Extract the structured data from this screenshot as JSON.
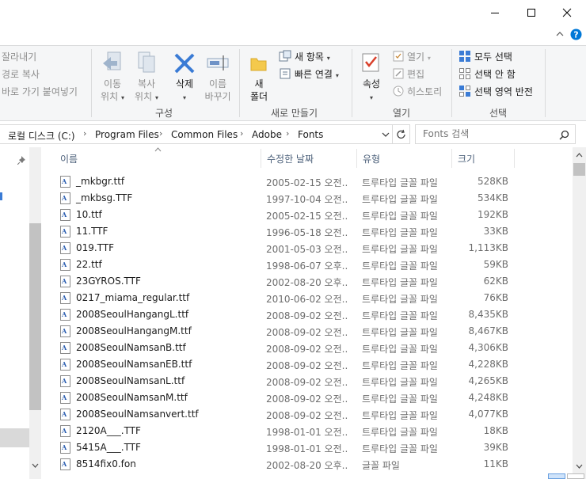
{
  "window": {
    "minimize_label": "minimize",
    "maximize_label": "maximize",
    "close_label": "close"
  },
  "ribbon": {
    "clipboard": {
      "cut": "잘라내기",
      "copy_path": "경로 복사",
      "paste_shortcut": "바로 가기 붙여넣기"
    },
    "organize": {
      "move_line1": "이동",
      "move_line2": "위치",
      "copy_line1": "복사",
      "copy_line2": "위치",
      "delete": "삭제",
      "rename_line1": "이름",
      "rename_line2": "바꾸기",
      "group_label": "구성"
    },
    "new": {
      "folder_line1": "새",
      "folder_line2": "폴더",
      "new_item": "새 항목",
      "easy_access": "빠른 연결",
      "group_label": "새로 만들기"
    },
    "open": {
      "properties": "속성",
      "open": "열기",
      "edit": "편집",
      "history": "히스토리",
      "group_label": "열기"
    },
    "select": {
      "select_all": "모두 선택",
      "select_none": "선택 안 함",
      "invert": "선택 영역 반전",
      "group_label": "선택"
    }
  },
  "address": {
    "crumbs": [
      "로컬 디스크 (C:)",
      "Program Files",
      "Common Files",
      "Adobe",
      "Fonts"
    ],
    "search_placeholder": "Fonts 검색"
  },
  "columns": {
    "name": "이름",
    "date": "수정한 날짜",
    "type": "유형",
    "size": "크기"
  },
  "files": [
    {
      "name": "_mkbgr.ttf",
      "date": "2005-02-15 오전...",
      "type": "트루타입 글꼴 파일",
      "size": "528KB"
    },
    {
      "name": "_mkbsg.TTF",
      "date": "1997-10-04 오전...",
      "type": "트루타입 글꼴 파일",
      "size": "534KB"
    },
    {
      "name": "10.ttf",
      "date": "2005-02-15 오전...",
      "type": "트루타입 글꼴 파일",
      "size": "192KB"
    },
    {
      "name": "11.TTF",
      "date": "1996-05-18 오전...",
      "type": "트루타입 글꼴 파일",
      "size": "33KB"
    },
    {
      "name": "019.TTF",
      "date": "2001-05-03 오전...",
      "type": "트루타입 글꼴 파일",
      "size": "1,113KB"
    },
    {
      "name": "22.ttf",
      "date": "1998-06-07 오후...",
      "type": "트루타입 글꼴 파일",
      "size": "59KB"
    },
    {
      "name": "23GYROS.TTF",
      "date": "2002-08-20 오후...",
      "type": "트루타입 글꼴 파일",
      "size": "62KB"
    },
    {
      "name": "0217_miama_regular.ttf",
      "date": "2010-06-02 오전...",
      "type": "트루타입 글꼴 파일",
      "size": "76KB"
    },
    {
      "name": "2008SeoulHangangL.ttf",
      "date": "2008-09-02 오전...",
      "type": "트루타입 글꼴 파일",
      "size": "8,435KB"
    },
    {
      "name": "2008SeoulHangangM.ttf",
      "date": "2008-09-02 오전...",
      "type": "트루타입 글꼴 파일",
      "size": "8,467KB"
    },
    {
      "name": "2008SeoulNamsanB.ttf",
      "date": "2008-09-02 오전...",
      "type": "트루타입 글꼴 파일",
      "size": "4,306KB"
    },
    {
      "name": "2008SeoulNamsanEB.ttf",
      "date": "2008-09-02 오전...",
      "type": "트루타입 글꼴 파일",
      "size": "4,228KB"
    },
    {
      "name": "2008SeoulNamsanL.ttf",
      "date": "2008-09-02 오전...",
      "type": "트루타입 글꼴 파일",
      "size": "4,265KB"
    },
    {
      "name": "2008SeoulNamsanM.ttf",
      "date": "2008-09-02 오전...",
      "type": "트루타입 글꼴 파일",
      "size": "4,248KB"
    },
    {
      "name": "2008SeoulNamsanvert.ttf",
      "date": "2008-09-02 오전...",
      "type": "트루타입 글꼴 파일",
      "size": "4,077KB"
    },
    {
      "name": "2120A___.TTF",
      "date": "1998-01-01 오전...",
      "type": "트루타입 글꼴 파일",
      "size": "18KB"
    },
    {
      "name": "5415A___.TTF",
      "date": "1998-01-01 오전...",
      "type": "트루타입 글꼴 파일",
      "size": "39KB"
    },
    {
      "name": "8514fix0.fon",
      "date": "2002-08-20 오후...",
      "type": "글꼴 파일",
      "size": "11KB"
    }
  ],
  "colors": {
    "accent": "#0078d7",
    "header_text": "#4c607a",
    "delete_icon": "#3a7bd5"
  }
}
